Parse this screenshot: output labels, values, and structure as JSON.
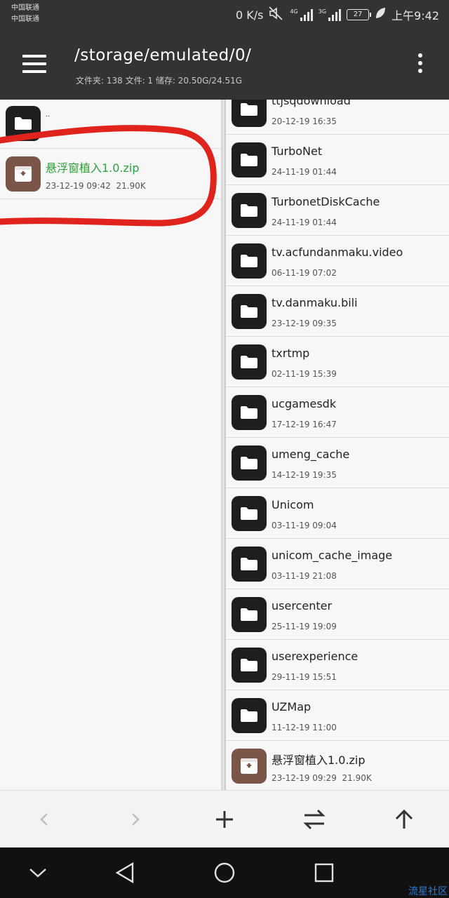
{
  "status_bar": {
    "carrier_1": "中国联通",
    "carrier_2": "中国联通",
    "speed": "0 K/s",
    "net_4g": "4G",
    "net_3g": "3G",
    "battery": "27",
    "time": "上午9:42",
    "icons": [
      "mute-icon",
      "signal-icon",
      "battery-icon",
      "leaf-icon"
    ]
  },
  "toolbar": {
    "path": "/storage/emulated/0/",
    "stats": "文件夹: 138   文件: 1   储存: 20.50G/24.51G",
    "icons": [
      "menu-icon",
      "more-icon"
    ]
  },
  "left_pane": {
    "up": {
      "name": "..",
      "icon": "folder-icon"
    },
    "items": [
      {
        "name": "悬浮窗植入1.0.zip",
        "date": "23-12-19 09:42",
        "size": "21.90K",
        "type": "zip",
        "highlighted": true
      }
    ]
  },
  "right_pane": {
    "items": [
      {
        "name": "ttjsqdownload",
        "date": "20-12-19 16:35",
        "type": "folder"
      },
      {
        "name": "TurboNet",
        "date": "24-11-19 01:44",
        "type": "folder"
      },
      {
        "name": "TurbonetDiskCache",
        "date": "24-11-19 01:44",
        "type": "folder"
      },
      {
        "name": "tv.acfundanmaku.video",
        "date": "06-11-19 07:02",
        "type": "folder"
      },
      {
        "name": "tv.danmaku.bili",
        "date": "23-12-19 09:35",
        "type": "folder"
      },
      {
        "name": "txrtmp",
        "date": "02-11-19 15:39",
        "type": "folder"
      },
      {
        "name": "ucgamesdk",
        "date": "17-12-19 16:47",
        "type": "folder"
      },
      {
        "name": "umeng_cache",
        "date": "14-12-19 19:35",
        "type": "folder"
      },
      {
        "name": "Unicom",
        "date": "03-11-19 09:04",
        "type": "folder"
      },
      {
        "name": "unicom_cache_image",
        "date": "03-11-19 21:08",
        "type": "folder"
      },
      {
        "name": "usercenter",
        "date": "25-11-19 19:09",
        "type": "folder"
      },
      {
        "name": "userexperience",
        "date": "29-11-19 15:51",
        "type": "folder"
      },
      {
        "name": "UZMap",
        "date": "11-12-19 11:00",
        "type": "folder"
      },
      {
        "name": "悬浮窗植入1.0.zip",
        "date": "23-12-19 09:29",
        "size": "21.90K",
        "type": "zip"
      }
    ]
  },
  "bottom_bar": {
    "buttons": [
      "back-icon",
      "forward-icon",
      "add-icon",
      "swap-icon",
      "up-icon"
    ]
  },
  "nav_bar": {
    "buttons": [
      "collapse-icon",
      "nav-back-icon",
      "home-icon",
      "recents-icon"
    ]
  },
  "watermark": "流星社区",
  "colors": {
    "toolbar": "#333333",
    "highlight_text": "#2e9e3a",
    "zip_icon": "#7a5548",
    "annotation": "#e0231c"
  }
}
